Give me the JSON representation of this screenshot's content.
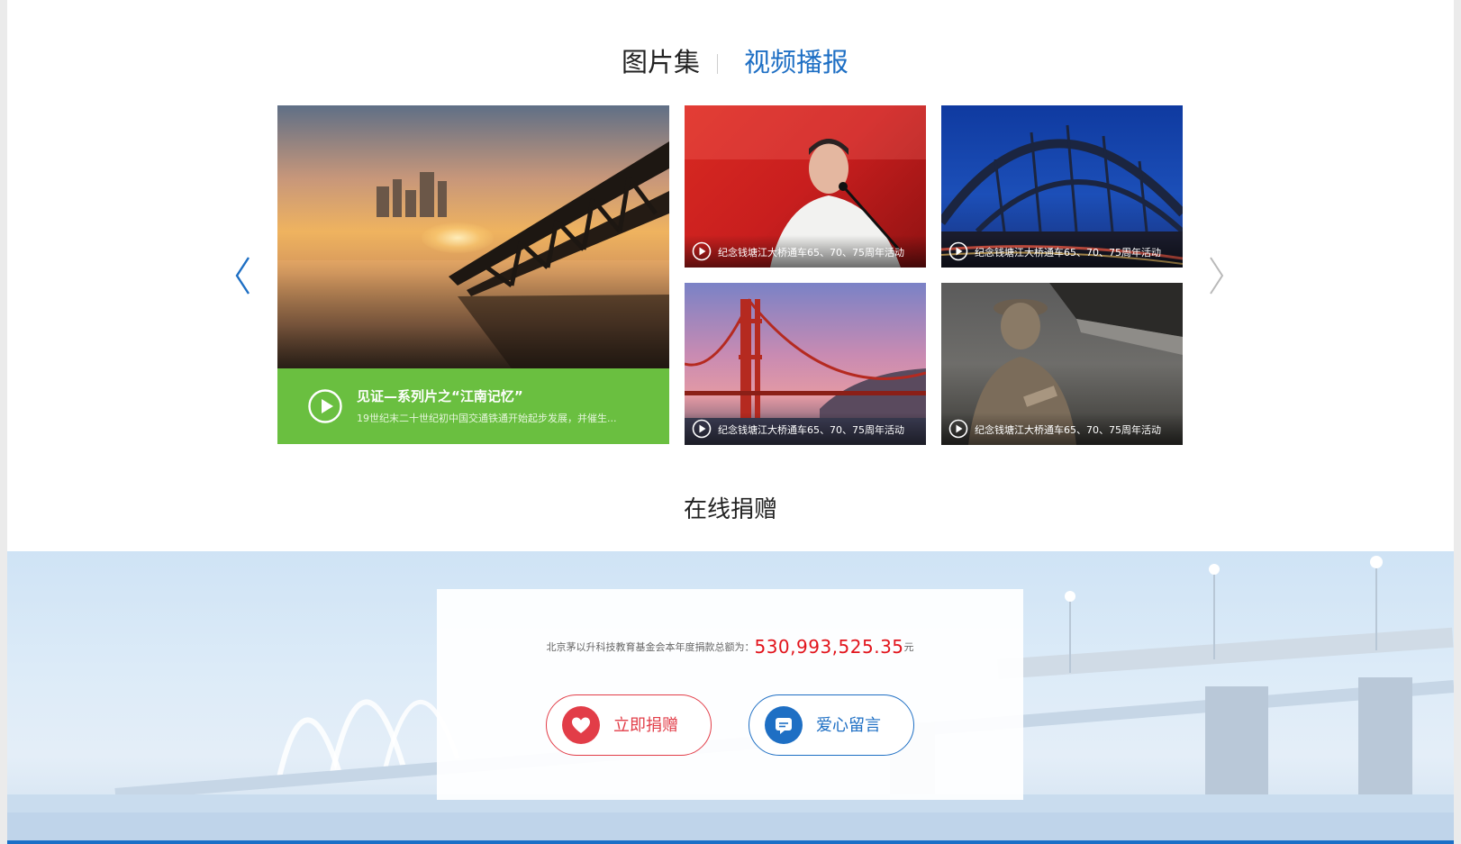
{
  "tabs": {
    "photos": "图片集",
    "video": "视频播报"
  },
  "feature": {
    "title": "见证—系列片之“江南记忆”",
    "description": "19世纪末二十世纪初中国交通铁通开始起步发展，并催生..."
  },
  "tiles": [
    {
      "caption": "纪念钱塘江大桥通车65、70、75周年活动"
    },
    {
      "caption": "纪念钱塘江大桥通车65、70、75周年活动"
    },
    {
      "caption": "纪念钱塘江大桥通车65、70、75周年活动"
    },
    {
      "caption": "纪念钱塘江大桥通车65、70、75周年活动"
    }
  ],
  "donation": {
    "title": "在线捐赠",
    "total_label": "北京茅以升科技教育基金会本年度捐款总额为：",
    "total_amount": "530,993,525.35",
    "total_unit": "元",
    "donate_button": "立即捐赠",
    "message_button": "爱心留言"
  },
  "icons": {
    "prev": "chevron-left-icon",
    "next": "chevron-right-icon",
    "play": "play-icon",
    "heart": "heart-icon",
    "message": "message-icon"
  },
  "colors": {
    "accent_blue": "#1e6fc4",
    "feature_green": "#6abf40",
    "donate_red": "#e23d48",
    "amount_red": "#e2141c"
  }
}
